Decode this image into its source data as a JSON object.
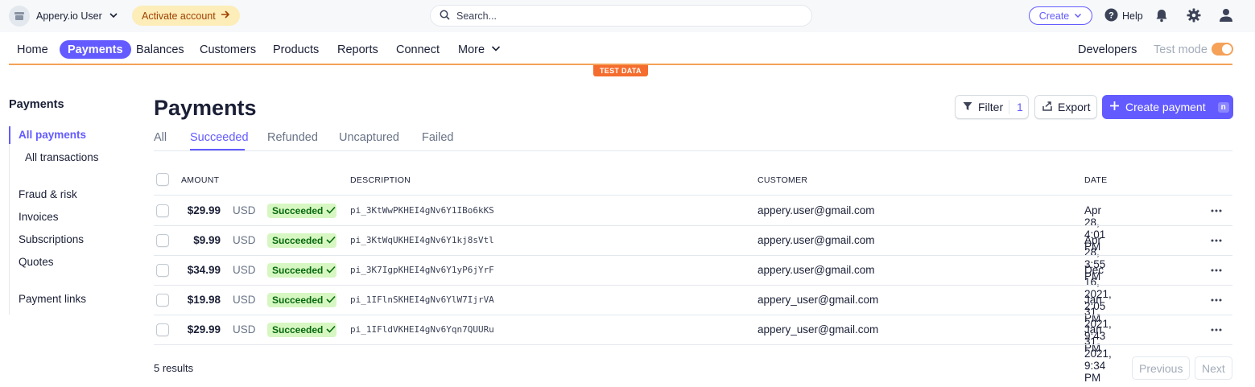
{
  "topbar": {
    "account_name": "Appery.io User",
    "activate_label": "Activate account",
    "search_placeholder": "Search...",
    "create_label": "Create",
    "help_label": "Help"
  },
  "nav": {
    "items": [
      "Home",
      "Payments",
      "Balances",
      "Customers",
      "Products",
      "Reports",
      "Connect",
      "More"
    ],
    "active": "Payments",
    "developers": "Developers",
    "test_mode": "Test mode",
    "test_mode_on": true,
    "test_data_banner": "TEST DATA"
  },
  "sidebar": {
    "title": "Payments",
    "items": [
      "All payments",
      "All transactions",
      "Fraud & risk",
      "Invoices",
      "Subscriptions",
      "Quotes",
      "Payment links"
    ],
    "active": "All payments"
  },
  "main": {
    "title": "Payments",
    "filter_label": "Filter",
    "filter_count": "1",
    "export_label": "Export",
    "create_payment_label": "Create payment",
    "create_payment_shortcut": "n",
    "tabs": [
      "All",
      "Succeeded",
      "Refunded",
      "Uncaptured",
      "Failed"
    ],
    "active_tab": "Succeeded",
    "columns": [
      "AMOUNT",
      "DESCRIPTION",
      "CUSTOMER",
      "DATE"
    ],
    "rows": [
      {
        "amount": "$29.99",
        "currency": "USD",
        "status": "Succeeded",
        "description": "pi_3KtWwPKHEI4gNv6Y1IBo6kKS",
        "customer": "appery.user@gmail.com",
        "date": "Apr 28, 4:01 PM"
      },
      {
        "amount": "$9.99",
        "currency": "USD",
        "status": "Succeeded",
        "description": "pi_3KtWqUKHEI4gNv6Y1kj8sVtl",
        "customer": "appery.user@gmail.com",
        "date": "Apr 28, 3:55 PM"
      },
      {
        "amount": "$34.99",
        "currency": "USD",
        "status": "Succeeded",
        "description": "pi_3K7IgpKHEI4gNv6Y1yP6jYrF",
        "customer": "appery.user@gmail.com",
        "date": "Dec 16, 2021, 2:05 PM"
      },
      {
        "amount": "$19.98",
        "currency": "USD",
        "status": "Succeeded",
        "description": "pi_1IFlnSKHEI4gNv6YlW7IjrVA",
        "customer": "appery_user@gmail.com",
        "date": "Jan 31, 2021, 9:43 PM"
      },
      {
        "amount": "$29.99",
        "currency": "USD",
        "status": "Succeeded",
        "description": "pi_1IFldVKHEI4gNv6Yqn7QUURu",
        "customer": "appery_user@gmail.com",
        "date": "Jan 31, 2021, 9:34 PM"
      }
    ],
    "results": "5 results",
    "previous_label": "Previous",
    "next_label": "Next"
  },
  "colors": {
    "accent": "#635bff",
    "test_orange": "#f56d2e",
    "success_bg": "#d7f7c2",
    "success_text": "#05690d"
  }
}
